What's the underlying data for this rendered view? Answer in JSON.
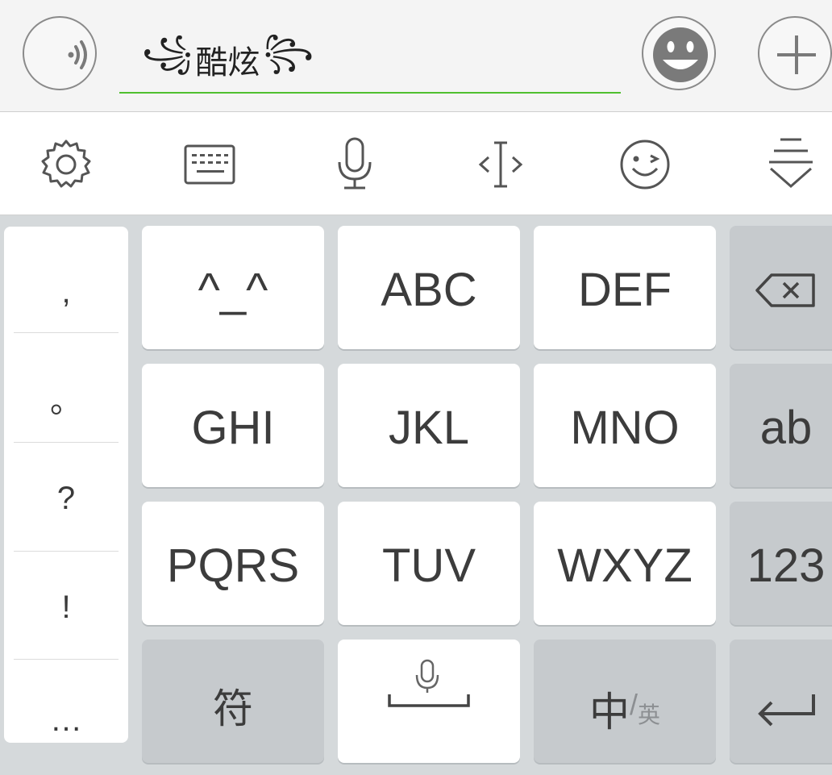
{
  "input": {
    "text_left_decor": "꧁",
    "text": "酷炫",
    "text_right_decor": "꧂"
  },
  "top_buttons": {
    "voice_icon": "voice-wave-icon",
    "emoji_icon": "smiley-icon",
    "add_icon": "plus-icon"
  },
  "toolbar": {
    "items": [
      {
        "name": "settings",
        "icon": "gear-icon"
      },
      {
        "name": "keyboard",
        "icon": "keyboard-icon"
      },
      {
        "name": "microphone",
        "icon": "microphone-icon"
      },
      {
        "name": "cursor",
        "icon": "cursor-move-icon"
      },
      {
        "name": "emoji",
        "icon": "wink-icon"
      },
      {
        "name": "collapse",
        "icon": "collapse-keyboard-icon"
      }
    ]
  },
  "symbols": [
    ",",
    "。",
    "?",
    "!",
    "…"
  ],
  "keys": {
    "row1": [
      "^_^",
      "ABC",
      "DEF"
    ],
    "row2": [
      "GHI",
      "JKL",
      "MNO"
    ],
    "row3": [
      "PQRS",
      "TUV",
      "WXYZ"
    ],
    "side": {
      "backspace_icon": "backspace-icon",
      "ab": "ab",
      "num": "123",
      "enter_icon": "return-arrow-icon"
    },
    "bottom": {
      "symbol": "符",
      "lang_main": "中",
      "lang_sep": "/",
      "lang_alt": "英"
    }
  },
  "colors": {
    "accent_underline": "#4fbf2f",
    "key_bg": "#ffffff",
    "func_key_bg": "#c6cacd",
    "keyboard_bg": "#d5d9db"
  }
}
